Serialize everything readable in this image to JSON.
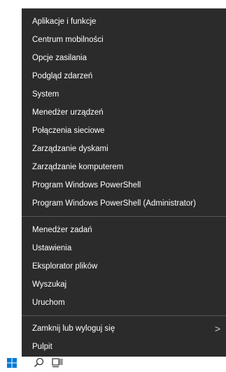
{
  "menu": {
    "groups": [
      [
        {
          "label": "Aplikacje i funkcje"
        },
        {
          "label": "Centrum mobilności"
        },
        {
          "label": "Opcje zasilania"
        },
        {
          "label": "Podgląd zdarzeń"
        },
        {
          "label": "System"
        },
        {
          "label": "Menedżer urządzeń"
        },
        {
          "label": "Połączenia sieciowe"
        },
        {
          "label": "Zarządzanie dyskami"
        },
        {
          "label": "Zarządzanie komputerem"
        },
        {
          "label": "Program Windows PowerShell"
        },
        {
          "label": "Program Windows PowerShell (Administrator)"
        }
      ],
      [
        {
          "label": "Menedżer zadań"
        },
        {
          "label": "Ustawienia"
        },
        {
          "label": "Eksplorator plików"
        },
        {
          "label": "Wyszukaj"
        },
        {
          "label": "Uruchom"
        }
      ],
      [
        {
          "label": "Zamknij lub wyloguj się",
          "submenu_glyph": ">"
        },
        {
          "label": "Pulpit"
        }
      ]
    ]
  },
  "taskbar": {
    "icons": [
      "windows-start-icon",
      "search-icon",
      "task-view-icon"
    ]
  },
  "colors": {
    "menu_bg": "#2b2b2b",
    "text": "#ffffff",
    "separator": "#565656",
    "start_blue": "#0078d7"
  }
}
